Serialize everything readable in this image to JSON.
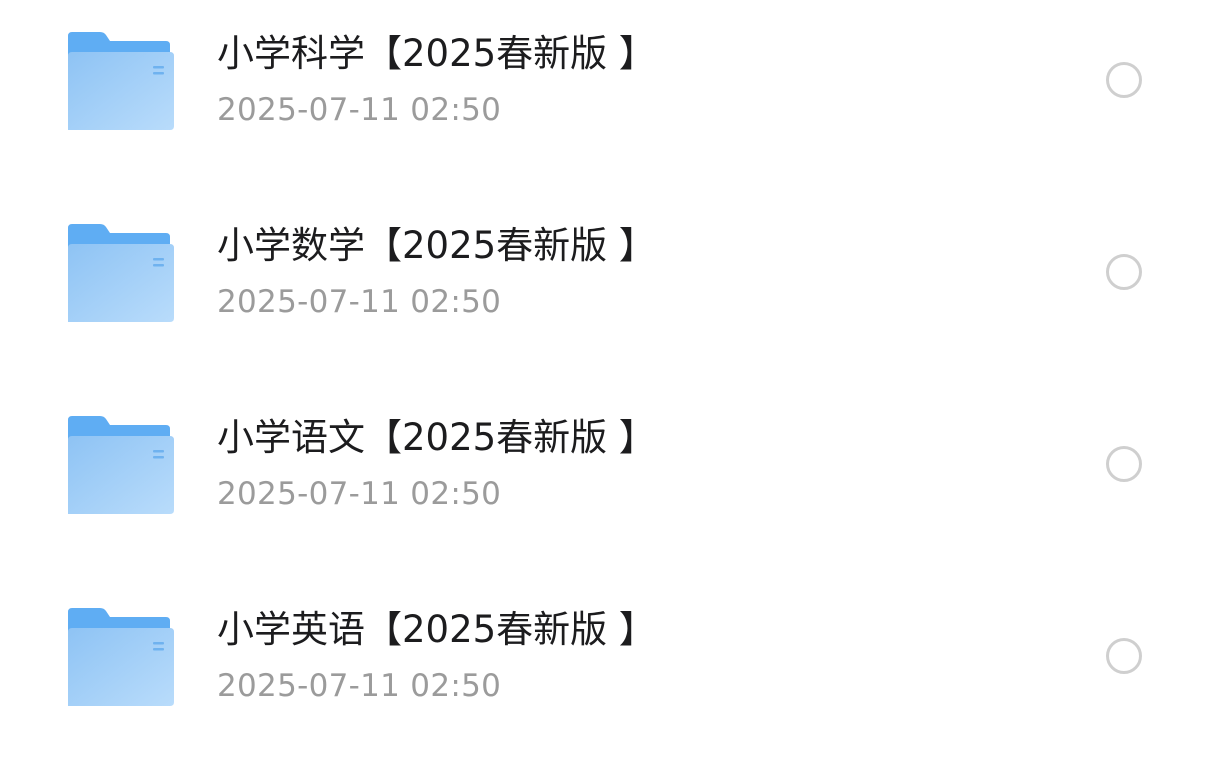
{
  "folder_icon": "folder-icon",
  "colors": {
    "folder_back": "#5fadf3",
    "folder_front_start": "#8ec3f4",
    "folder_front_end": "#b9dcfb",
    "name_text": "#1c1c1e",
    "date_text": "#9b9b9b",
    "radio_border": "#cfcfcf"
  },
  "files": [
    {
      "name": "小学科学【2025春新版 】",
      "date": "2025-07-11 02:50",
      "selected": false
    },
    {
      "name": "小学数学【2025春新版 】",
      "date": "2025-07-11 02:50",
      "selected": false
    },
    {
      "name": "小学语文【2025春新版 】",
      "date": "2025-07-11 02:50",
      "selected": false
    },
    {
      "name": "小学英语【2025春新版 】",
      "date": "2025-07-11 02:50",
      "selected": false
    }
  ]
}
